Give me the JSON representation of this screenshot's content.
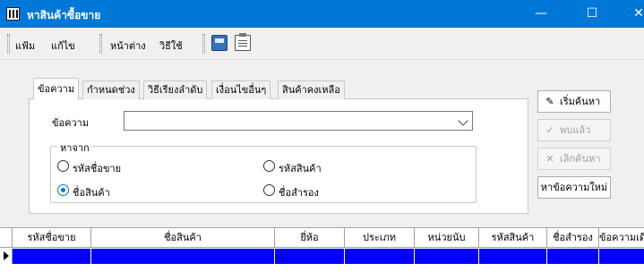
{
  "window": {
    "title": "หาสินค้าซื้อขาย",
    "minimize": "—",
    "maximize": "☐",
    "close": "✕"
  },
  "menu": {
    "items": [
      "แฟ้ม",
      "แก้ไข",
      "หน้าต่าง",
      "วิธีใช้"
    ]
  },
  "toolbar": {
    "icons": [
      "calculator-icon",
      "clipboard-icon"
    ]
  },
  "tabs": [
    "ข้อความ",
    "กำหนดช่วง",
    "วิธีเรียงลำดับ",
    "เงื่อนไขอื่นๆ",
    "สินค้าคงเหลือ"
  ],
  "form": {
    "text_label": "ข้อความ",
    "text_value": "",
    "search_from_label": "หาจาก",
    "options": [
      {
        "label": "รหัสชื่อขาย",
        "checked": false
      },
      {
        "label": "รหัสสินค้า",
        "checked": false
      },
      {
        "label": "ชื่อสินค้า",
        "checked": true
      },
      {
        "label": "ชื่อสำรอง",
        "checked": false
      }
    ]
  },
  "buttons": {
    "search": "เริ่มค้นหา",
    "found": "พบแล้ว",
    "cancel": "เลิกค้นหา",
    "new_search": "หาข้อความใหม่"
  },
  "grid": {
    "columns": [
      "รหัสชื่อขาย",
      "ชื่อสินค้า",
      "ยี่ห้อ",
      "ประเภท",
      "หน่วยนับ",
      "รหัสสินค้า",
      "ชื่อสำรอง",
      "ข้อความเดิ"
    ],
    "selected_row_color": "#0000ff"
  },
  "colors": {
    "titlebar": "#0078d7",
    "accent": "#0078d7"
  }
}
